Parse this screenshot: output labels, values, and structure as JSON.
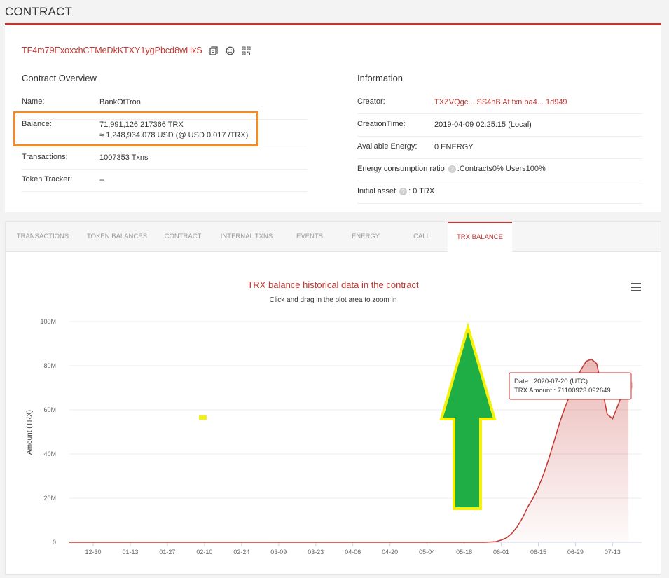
{
  "page": {
    "title": "CONTRACT"
  },
  "contract": {
    "address": "TF4m79ExoxxhCTMeDkKTXY1ygPbcd8wHxS",
    "icons": [
      "copy-icon",
      "smile-icon",
      "qrcode-icon"
    ]
  },
  "overview": {
    "title": "Contract Overview",
    "name_label": "Name:",
    "name_value": "BankOfTron",
    "balance_label": "Balance:",
    "balance_trx": "71,991,126.217366 TRX",
    "balance_usd": "≈ 1,248,934.078 USD (@ USD 0.017 /TRX)",
    "transactions_label": "Transactions:",
    "transactions_value": "1007353  Txns",
    "token_tracker_label": "Token Tracker:",
    "token_tracker_value": "--"
  },
  "information": {
    "title": "Information",
    "creator_label": "Creator:",
    "creator_value": "TXZVQgc... SS4hB  At txn  ba4... 1d949",
    "creation_time_label": "CreationTime:",
    "creation_time_value": "2019-04-09 02:25:15 (Local)",
    "energy_label": "Available Energy:",
    "energy_value": "0  ENERGY",
    "ratio_label": "Energy consumption ratio",
    "ratio_value": ":Contracts0%   Users100%",
    "initial_label": "Initial asset",
    "initial_value": ":      0 TRX"
  },
  "tabs": [
    {
      "label": "TRANSACTIONS",
      "active": false
    },
    {
      "label": "TOKEN BALANCES",
      "active": false
    },
    {
      "label": "CONTRACT",
      "active": false
    },
    {
      "label": "INTERNAL TXNS",
      "active": false
    },
    {
      "label": "EVENTS",
      "active": false
    },
    {
      "label": "ENERGY",
      "active": false
    },
    {
      "label": "CALL",
      "active": false
    },
    {
      "label": "TRX BALANCE",
      "active": true
    }
  ],
  "chart_panel": {
    "title": "TRX balance historical data in the contract",
    "subtitle": "Click and drag in the plot area to zoom in"
  },
  "colors": {
    "accent": "#c23631",
    "highlight": "#f28c28",
    "arrow_fill": "#1fad46",
    "arrow_stroke": "#f5f20a"
  },
  "chart_data": {
    "type": "area",
    "title": "TRX balance historical data in the contract",
    "subtitle": "Click and drag in the plot area to zoom in",
    "xlabel": "",
    "ylabel": "Amount  (TRX)",
    "x_tick_labels": [
      "12-30",
      "01-13",
      "01-27",
      "02-10",
      "02-24",
      "03-09",
      "03-23",
      "04-06",
      "04-20",
      "05-04",
      "05-18",
      "06-01",
      "06-15",
      "06-29",
      "07-13"
    ],
    "x_tick_days": [
      0,
      14,
      28,
      42,
      56,
      70,
      84,
      98,
      112,
      126,
      140,
      154,
      168,
      182,
      196
    ],
    "y_tick_labels": [
      "0",
      "20M",
      "40M",
      "60M",
      "80M",
      "100M"
    ],
    "ylim": [
      0,
      100000000
    ],
    "xlim_days": [
      -9,
      207
    ],
    "grid": true,
    "legend": "none",
    "x": [
      -9,
      140,
      148,
      152,
      154,
      156,
      158,
      160,
      162,
      164,
      166,
      168,
      170,
      172,
      174,
      176,
      178,
      180,
      182,
      184,
      186,
      188,
      190,
      192,
      194,
      196,
      198,
      200,
      202
    ],
    "y": [
      0,
      0,
      0,
      300000,
      1000000,
      2000000,
      4000000,
      7000000,
      11000000,
      16000000,
      20000000,
      25000000,
      31000000,
      38000000,
      46000000,
      54000000,
      61000000,
      67000000,
      73000000,
      78000000,
      82000000,
      83000000,
      81000000,
      70000000,
      58000000,
      56000000,
      62000000,
      68000000,
      71100923
    ],
    "tooltip": {
      "date_label": "Date : 2020-07-20 (UTC)",
      "amount_label": "TRX Amount : 71100923.092649"
    }
  }
}
